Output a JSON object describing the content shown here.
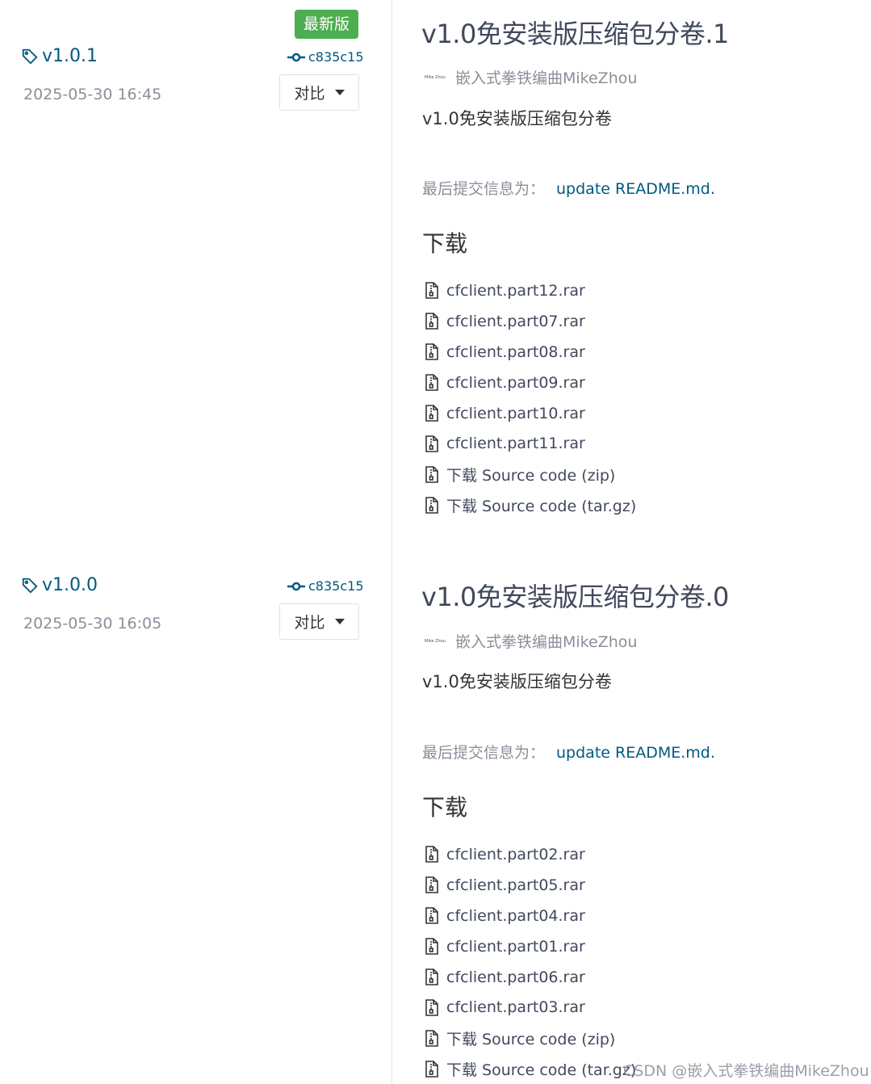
{
  "releases": [
    {
      "latest_badge": "最新版",
      "tag": "v1.0.1",
      "date": "2025-05-30 16:45",
      "commit": "c835c15",
      "compare_label": "对比",
      "title": "v1.0免安装版压缩包分卷.1",
      "avatar_text": "Mike Zhou",
      "author": "嵌入式拳铁编曲MikeZhou",
      "description": "v1.0免安装版压缩包分卷",
      "commit_msg_label": "最后提交信息为：",
      "commit_msg_link": "update README.md.",
      "download_heading": "下载",
      "files": [
        "cfclient.part12.rar",
        "cfclient.part07.rar",
        "cfclient.part08.rar",
        "cfclient.part09.rar",
        "cfclient.part10.rar",
        "cfclient.part11.rar",
        "下载 Source code (zip)",
        "下载 Source code (tar.gz)"
      ]
    },
    {
      "tag": "v1.0.0",
      "date": "2025-05-30 16:05",
      "commit": "c835c15",
      "compare_label": "对比",
      "title": "v1.0免安装版压缩包分卷.0",
      "avatar_text": "Mike Zhou",
      "author": "嵌入式拳铁编曲MikeZhou",
      "description": "v1.0免安装版压缩包分卷",
      "commit_msg_label": "最后提交信息为：",
      "commit_msg_link": "update README.md.",
      "download_heading": "下载",
      "files": [
        "cfclient.part02.rar",
        "cfclient.part05.rar",
        "cfclient.part04.rar",
        "cfclient.part01.rar",
        "cfclient.part06.rar",
        "cfclient.part03.rar",
        "下载 Source code (zip)",
        "下载 Source code (tar.gz)"
      ]
    }
  ],
  "icons": {
    "tag": "tag-icon",
    "commit": "commit-icon",
    "file": "file-zip-icon",
    "caret": "caret-down-icon"
  },
  "colors": {
    "link": "#005980",
    "badge": "#4cae4f",
    "muted": "#8a8f99"
  },
  "watermark": "CSDN @嵌入式拳铁编曲MikeZhou"
}
